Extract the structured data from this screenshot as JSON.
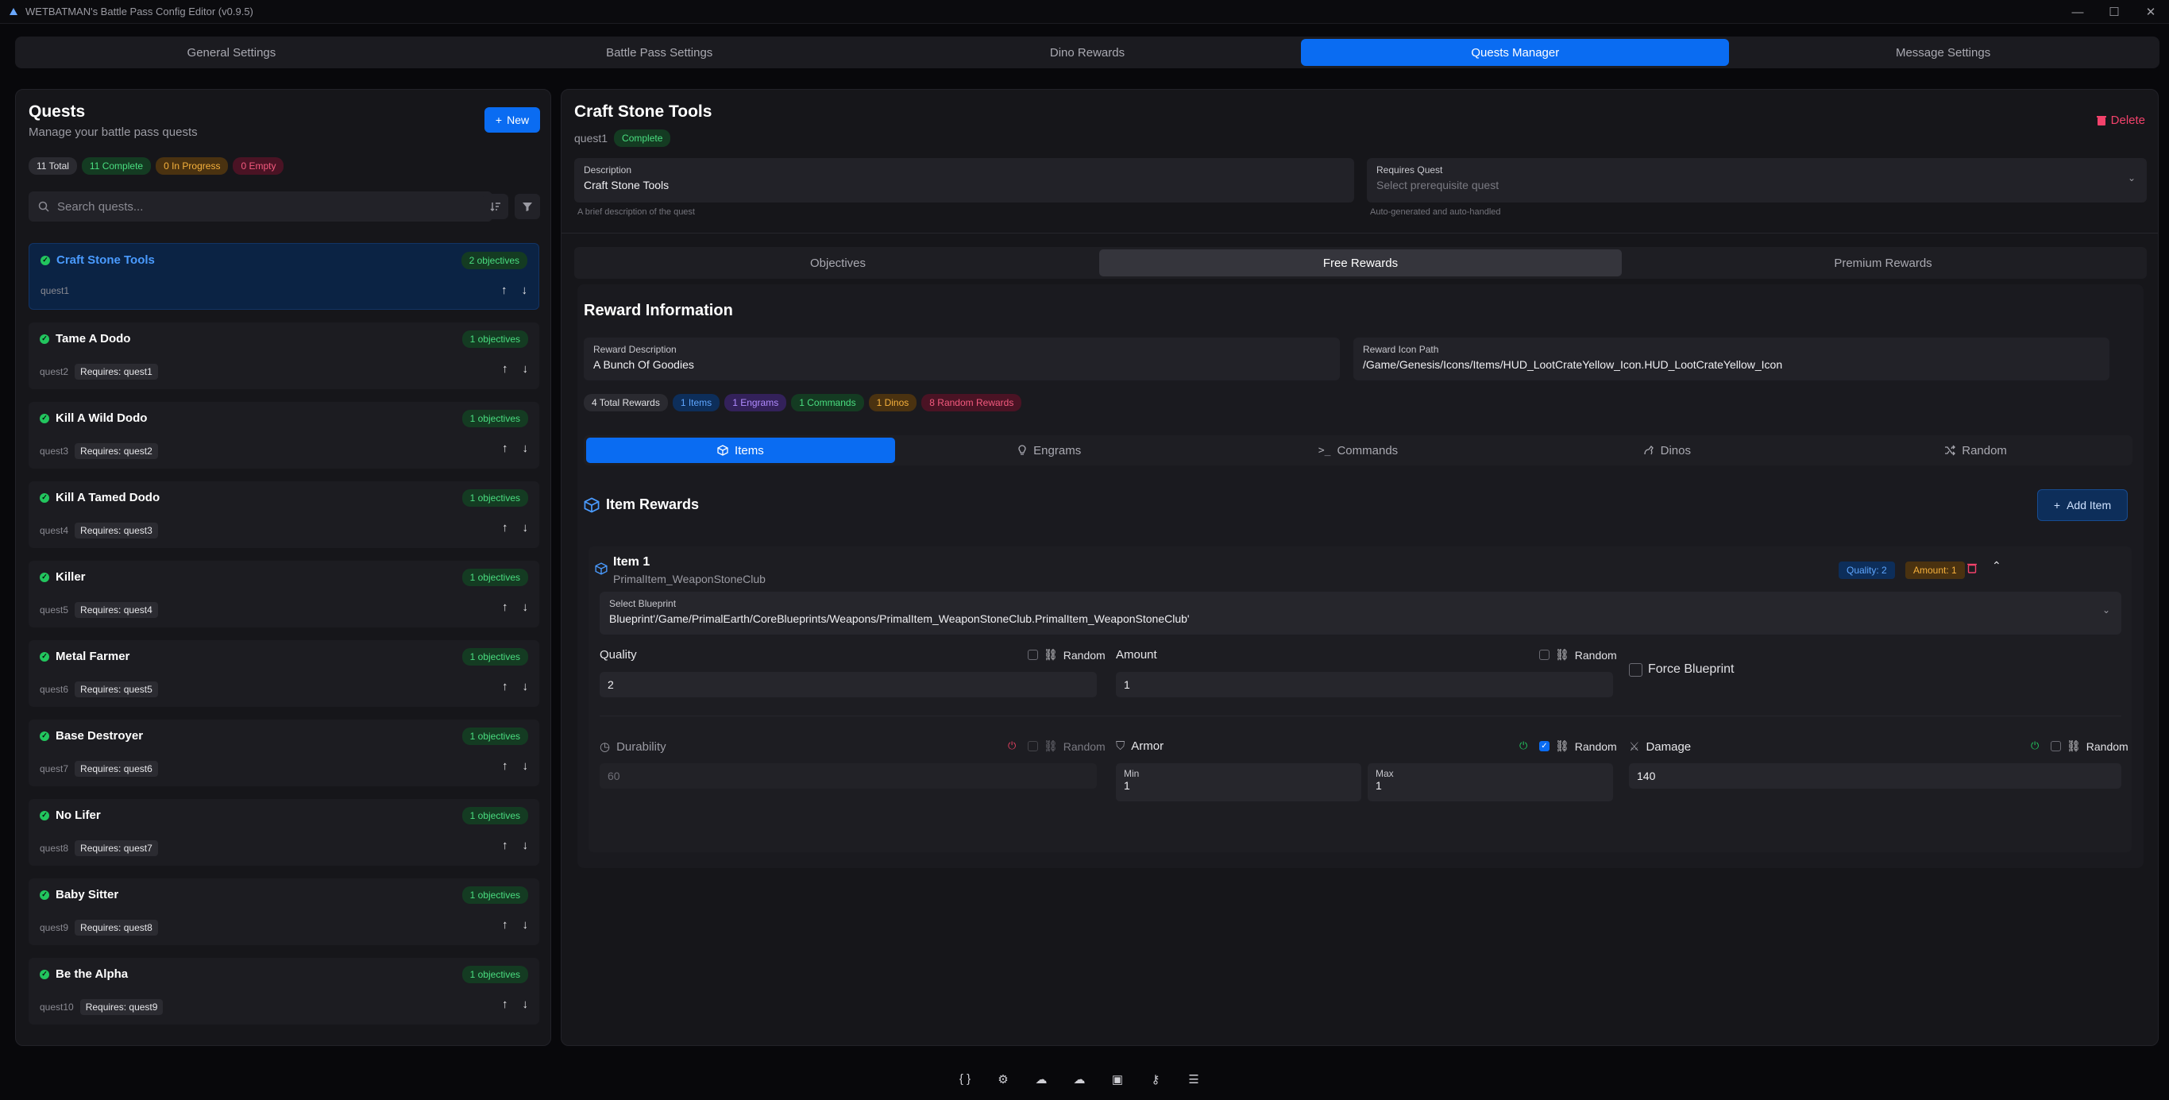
{
  "window": {
    "title": "WETBATMAN's Battle Pass Config Editor (v0.9.5)",
    "controls": [
      "—",
      "☐",
      "✕"
    ]
  },
  "nav": {
    "tabs": [
      "General Settings",
      "Battle Pass Settings",
      "Dino Rewards",
      "Quests Manager",
      "Message Settings"
    ],
    "active": "Quests Manager"
  },
  "quests_panel": {
    "title": "Quests",
    "subtitle": "Manage your battle pass quests",
    "new_label": "New",
    "stats": {
      "total": "11 Total",
      "complete": "11 Complete",
      "in_progress": "0 In Progress",
      "empty": "0 Empty"
    },
    "search_placeholder": "Search quests...",
    "items": [
      {
        "name": "Craft Stone Tools",
        "id": "quest1",
        "objectives": "2 objectives",
        "requires": ""
      },
      {
        "name": "Tame A Dodo",
        "id": "quest2",
        "objectives": "1 objectives",
        "requires": "Requires: quest1"
      },
      {
        "name": "Kill A Wild Dodo",
        "id": "quest3",
        "objectives": "1 objectives",
        "requires": "Requires: quest2"
      },
      {
        "name": "Kill A Tamed Dodo",
        "id": "quest4",
        "objectives": "1 objectives",
        "requires": "Requires: quest3"
      },
      {
        "name": "Killer",
        "id": "quest5",
        "objectives": "1 objectives",
        "requires": "Requires: quest4"
      },
      {
        "name": "Metal Farmer",
        "id": "quest6",
        "objectives": "1 objectives",
        "requires": "Requires: quest5"
      },
      {
        "name": "Base Destroyer",
        "id": "quest7",
        "objectives": "1 objectives",
        "requires": "Requires: quest6"
      },
      {
        "name": "No Lifer",
        "id": "quest8",
        "objectives": "1 objectives",
        "requires": "Requires: quest7"
      },
      {
        "name": "Baby Sitter",
        "id": "quest9",
        "objectives": "1 objectives",
        "requires": "Requires: quest8"
      },
      {
        "name": "Be the Alpha",
        "id": "quest10",
        "objectives": "1 objectives",
        "requires": "Requires: quest9"
      }
    ]
  },
  "detail": {
    "title": "Craft Stone Tools",
    "quest_id": "quest1",
    "status": "Complete",
    "delete_label": "Delete",
    "description_label": "Description",
    "description_value": "Craft Stone Tools",
    "description_hint": "A brief description of the quest",
    "requires_label": "Requires Quest",
    "requires_placeholder": "Select prerequisite quest",
    "requires_hint": "Auto-generated and auto-handled",
    "tabs": [
      "Objectives",
      "Free Rewards",
      "Premium Rewards"
    ],
    "active_tab": "Free Rewards"
  },
  "rewards": {
    "title": "Reward Information",
    "desc_label": "Reward Description",
    "desc_value": "A Bunch Of Goodies",
    "icon_label": "Reward Icon Path",
    "icon_value": "/Game/Genesis/Icons/Items/HUD_LootCrateYellow_Icon.HUD_LootCrateYellow_Icon",
    "stats": {
      "total": "4 Total Rewards",
      "items": "1 Items",
      "engrams": "1 Engrams",
      "commands": "1 Commands",
      "dinos": "1 Dinos",
      "random": "8 Random Rewards"
    },
    "type_tabs": [
      "Items",
      "Engrams",
      "Commands",
      "Dinos",
      "Random"
    ],
    "active_type": "Items"
  },
  "item_rewards": {
    "title": "Item Rewards",
    "add_label": "Add Item",
    "item": {
      "title": "Item 1",
      "class": "PrimalItem_WeaponStoneClub",
      "quality_badge": "Quality: 2",
      "amount_badge": "Amount: 1",
      "blueprint_label": "Select Blueprint",
      "blueprint_value": "Blueprint'/Game/PrimalEarth/CoreBlueprints/Weapons/PrimalItem_WeaponStoneClub.PrimalItem_WeaponStoneClub'",
      "quality_label": "Quality",
      "quality_value": "2",
      "amount_label": "Amount",
      "amount_value": "1",
      "random_label": "Random",
      "force_label": "Force Blueprint",
      "durability_label": "Durability",
      "durability_value": "60",
      "armor_label": "Armor",
      "armor_min_label": "Min",
      "armor_min": "1",
      "armor_max_label": "Max",
      "armor_max": "1",
      "damage_label": "Damage",
      "damage_value": "140"
    }
  },
  "bottom_icons": [
    "braces-icon",
    "gear-icon",
    "cloud-upload-icon",
    "cloud-download-icon",
    "save-icon",
    "key-icon",
    "search-list-icon"
  ]
}
